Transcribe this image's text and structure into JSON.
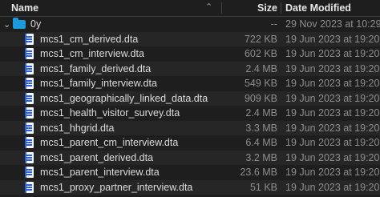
{
  "columns": {
    "name": "Name",
    "size": "Size",
    "date": "Date Modified",
    "sort_indicator": "chevron-up"
  },
  "folder": {
    "name": "0y",
    "size": "--",
    "date": "29 Nov 2023 at 10:29",
    "expanded": true
  },
  "files": [
    {
      "name": "mcs1_cm_derived.dta",
      "size": "722 KB",
      "date": "19 Jun 2023 at 19:20"
    },
    {
      "name": "mcs1_cm_interview.dta",
      "size": "602 KB",
      "date": "19 Jun 2023 at 19:20"
    },
    {
      "name": "mcs1_family_derived.dta",
      "size": "2.4 MB",
      "date": "19 Jun 2023 at 19:20"
    },
    {
      "name": "mcs1_family_interview.dta",
      "size": "549 KB",
      "date": "19 Jun 2023 at 19:20"
    },
    {
      "name": "mcs1_geographically_linked_data.dta",
      "size": "909 KB",
      "date": "19 Jun 2023 at 19:20"
    },
    {
      "name": "mcs1_health_visitor_survey.dta",
      "size": "2.4 MB",
      "date": "19 Jun 2023 at 19:20"
    },
    {
      "name": "mcs1_hhgrid.dta",
      "size": "3.3 MB",
      "date": "19 Jun 2023 at 19:20"
    },
    {
      "name": "mcs1_parent_cm_interview.dta",
      "size": "6.4 MB",
      "date": "19 Jun 2023 at 19:20"
    },
    {
      "name": "mcs1_parent_derived.dta",
      "size": "3.2 MB",
      "date": "19 Jun 2023 at 19:20"
    },
    {
      "name": "mcs1_parent_interview.dta",
      "size": "23.6 MB",
      "date": "19 Jun 2023 at 19:20"
    },
    {
      "name": "mcs1_proxy_partner_interview.dta",
      "size": "51 KB",
      "date": "19 Jun 2023 at 19:20"
    }
  ]
}
